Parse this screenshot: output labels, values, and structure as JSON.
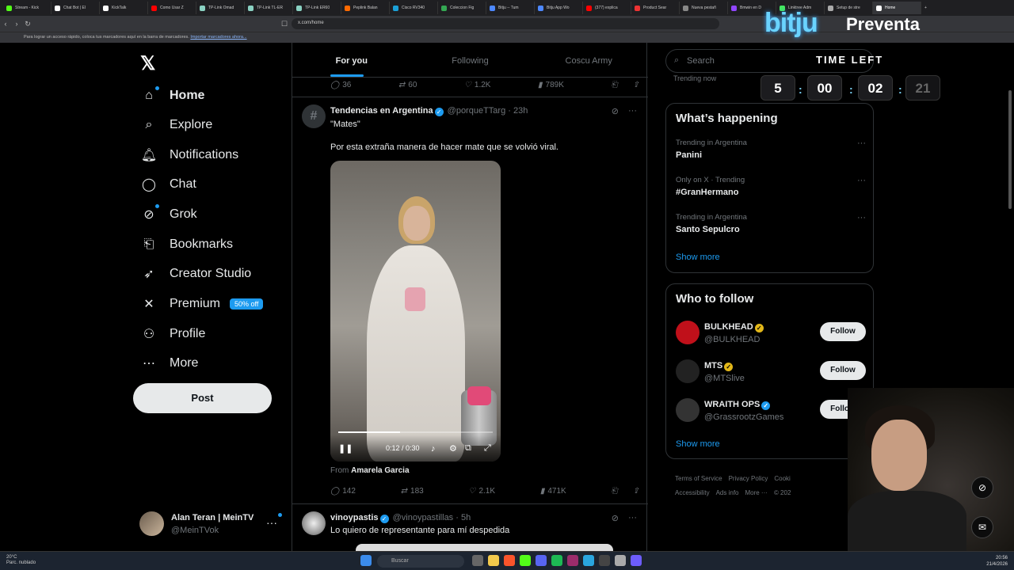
{
  "browser": {
    "tabs": [
      {
        "label": "Stream - Kick",
        "color": "#53fc18"
      },
      {
        "label": "Chat Bot | El",
        "color": "#ffffff"
      },
      {
        "label": "KickTalk",
        "color": "#ffffff"
      },
      {
        "label": "Como Usar Z",
        "color": "#ff0000"
      },
      {
        "label": "TP-Link Omad",
        "color": "#8ad1c2"
      },
      {
        "label": "TP-Link TL-ER",
        "color": "#8ad1c2"
      },
      {
        "label": "TP-Link ER60",
        "color": "#8ad1c2"
      },
      {
        "label": "Peplink Balan",
        "color": "#ff6a00"
      },
      {
        "label": "Cisco RV340",
        "color": "#1ba0d7"
      },
      {
        "label": "Coleccion Fig",
        "color": "#34a853"
      },
      {
        "label": "Bitju -- Tum",
        "color": "#4d88ff"
      },
      {
        "label": "Bitju App Wo",
        "color": "#4d88ff"
      },
      {
        "label": "(377) explica",
        "color": "#ff0000"
      },
      {
        "label": "Product Sear",
        "color": "#e33"
      },
      {
        "label": "Nueva pestañ",
        "color": "#888888"
      },
      {
        "label": "Bmwin en D",
        "color": "#9146ff"
      },
      {
        "label": "Linktree Adm",
        "color": "#43e660"
      },
      {
        "label": "Setup de stre",
        "color": "#aaaaaa"
      },
      {
        "label": "Home",
        "color": "#ffffff"
      }
    ],
    "new_tab": "+",
    "url": "x.com/home",
    "bookmarks_text": "Para lograr un acceso rápido, coloca tus marcadores aquí en la barra de marcadores.",
    "bookmarks_link": "Importar marcadores ahora..."
  },
  "sidebar": {
    "logo": "𝕏",
    "items": [
      {
        "label": "Home",
        "icon": "home-icon",
        "glyph": "⌂"
      },
      {
        "label": "Explore",
        "icon": "search-icon",
        "glyph": "⌕"
      },
      {
        "label": "Notifications",
        "icon": "bell-icon",
        "glyph": "🔔︎"
      },
      {
        "label": "Chat",
        "icon": "chat-icon",
        "glyph": "◯"
      },
      {
        "label": "Grok",
        "icon": "grok-icon",
        "glyph": "⊘"
      },
      {
        "label": "Bookmarks",
        "icon": "bookmark-icon",
        "glyph": "⎗"
      },
      {
        "label": "Creator Studio",
        "icon": "rocket-icon",
        "glyph": "➶"
      },
      {
        "label": "Premium",
        "icon": "x-icon",
        "glyph": "✕"
      },
      {
        "label": "Profile",
        "icon": "person-icon",
        "glyph": "⚇"
      },
      {
        "label": "More",
        "icon": "more-icon",
        "glyph": "⋯"
      }
    ],
    "premium_badge": "50% off",
    "post_button": "Post",
    "user": {
      "name": "Alan Teran | MeinTV",
      "handle": "@MeinTVok",
      "more": "···"
    }
  },
  "feed": {
    "tabs": [
      "For you",
      "Following",
      "Coscu Army"
    ],
    "prev_stats": {
      "replies": "36",
      "retweets": "60",
      "likes": "1.2K",
      "views": "789K"
    },
    "tweet": {
      "author": "Tendencias en Argentina",
      "handle": "@porqueTTarg",
      "time": "23h",
      "quote": "\"Mates\"",
      "text": "Por esta extraña manera de hacer mate que se volvió viral.",
      "video_time": "0:12 / 0:30",
      "video_progress": 0.4,
      "from_label": "From",
      "from_name": "Amarela Garcia",
      "stats": {
        "replies": "142",
        "retweets": "183",
        "likes": "2.1K",
        "views": "471K"
      }
    },
    "next_tweet": {
      "author": "vinoypastis",
      "handle": "@vinoypastillas",
      "time": "5h",
      "text": "Lo quiero de representante para mí despedida"
    }
  },
  "right": {
    "search_placeholder": "Search",
    "trending_now_partial": "Trending now",
    "happening_title": "What’s happening",
    "trends": [
      {
        "meta": "Trending in Argentina",
        "name": "Panini"
      },
      {
        "meta": "Only on X · Trending",
        "name": "#GranHermano"
      },
      {
        "meta": "Trending in Argentina",
        "name": "Santo Sepulcro"
      }
    ],
    "show_more": "Show more",
    "wtf_title": "Who to follow",
    "follows": [
      {
        "name": "BULKHEAD",
        "handle": "@BULKHEAD",
        "verified": "gold",
        "avatar_color": "#c0101a"
      },
      {
        "name": "MTS",
        "handle": "@MTSlive",
        "verified": "gold",
        "avatar_color": "#222222"
      },
      {
        "name": "WRAITH OPS",
        "handle": "@GrassrootzGames",
        "verified": "blue",
        "avatar_color": "#333333"
      }
    ],
    "follow_label": "Follow",
    "footer": [
      "Terms of Service",
      "Privacy Policy",
      "Cooki",
      "Accessibility",
      "Ads info",
      "More ···",
      "© 202"
    ]
  },
  "overlay": {
    "brand": "bitju",
    "preventa": "Preventa",
    "time_left": "TIME LEFT",
    "countdown": [
      "5",
      "00",
      "02",
      "21"
    ]
  },
  "taskbar": {
    "weather_temp": "20°C",
    "weather_desc": "Parc. nublado",
    "search": "Buscar",
    "time": "20:56",
    "date": "21/4/2026"
  }
}
